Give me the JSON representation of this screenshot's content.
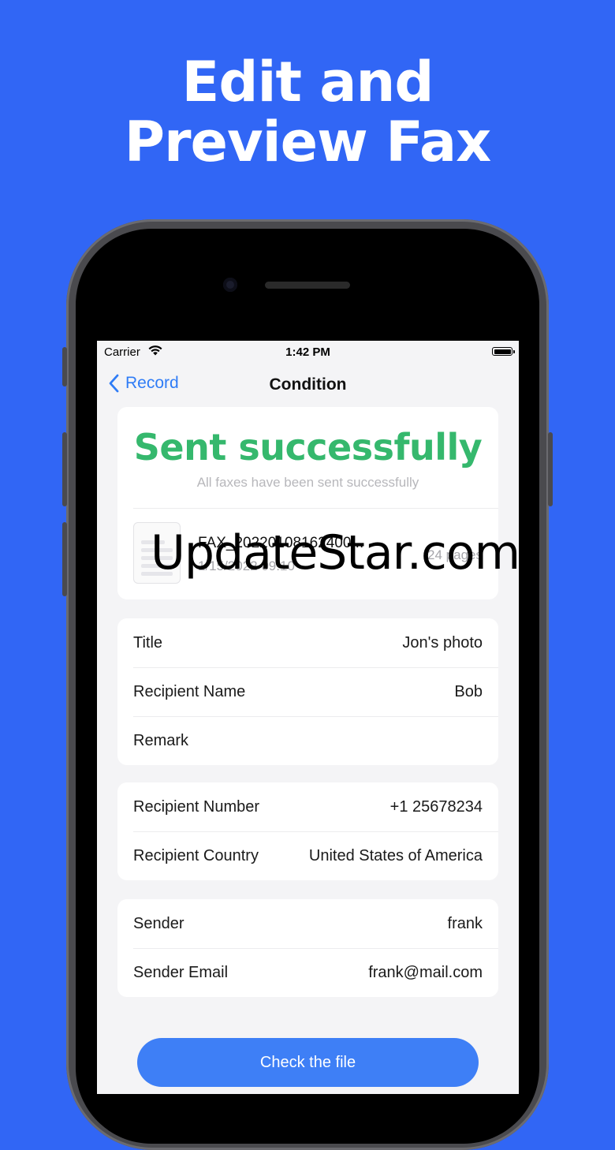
{
  "headline": {
    "line1": "Edit and",
    "line2": "Preview Fax"
  },
  "statusbar": {
    "carrier": "Carrier",
    "time": "1:42 PM"
  },
  "nav": {
    "back_label": "Record",
    "title": "Condition"
  },
  "status": {
    "title": "Sent successfully",
    "subtitle": "All faxes have been sent successfully"
  },
  "file": {
    "name": "FAX_20220108162400...",
    "date": "1/15/2022 09:10",
    "pages": "24 pages"
  },
  "watermark": "UpdateStar.com",
  "details": {
    "title_label": "Title",
    "title_value": "Jon's photo",
    "recipient_name_label": "Recipient Name",
    "recipient_name_value": "Bob",
    "remark_label": "Remark",
    "remark_value": ""
  },
  "recipient": {
    "number_label": "Recipient Number",
    "number_value": "+1 25678234",
    "country_label": "Recipient Country",
    "country_value": "United States of America"
  },
  "sender": {
    "name_label": "Sender",
    "name_value": "frank",
    "email_label": "Sender Email",
    "email_value": "frank@mail.com"
  },
  "actions": {
    "check_file_label": "Check the file"
  },
  "colors": {
    "background": "#3166f5",
    "accent": "#3e7ff6",
    "success": "#35b86d"
  }
}
